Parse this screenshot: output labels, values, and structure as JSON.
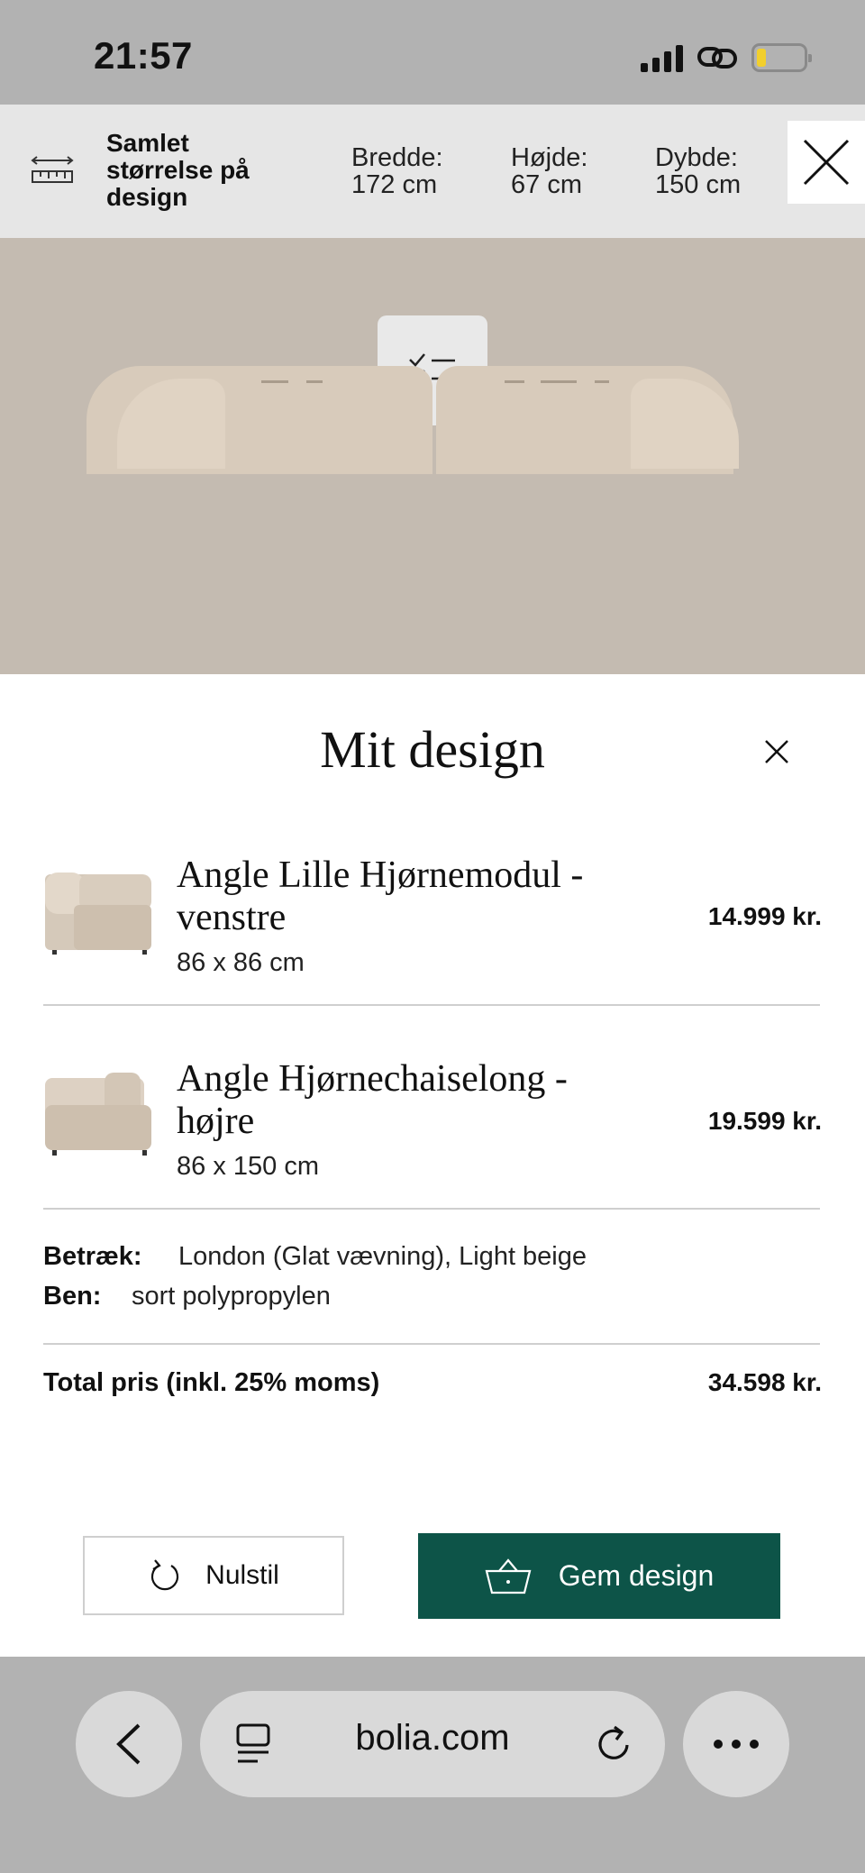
{
  "status_bar": {
    "time": "21:57"
  },
  "dimensions": {
    "title": "Samlet størrelse på design",
    "width_label": "Bredde:",
    "width_value": "172 cm",
    "height_label": "Højde:",
    "height_value": "67 cm",
    "depth_label": "Dybde:",
    "depth_value": "150 cm"
  },
  "panel": {
    "title": "Mit design",
    "items": [
      {
        "name": "Angle Lille Hjørnemodul - venstre",
        "size": "86 x 86 cm",
        "price": "14.999 kr."
      },
      {
        "name": "Angle Hjørnechaiselong - højre",
        "size": "86 x 150 cm",
        "price": "19.599 kr."
      }
    ],
    "specs": {
      "cover_label": "Betræk:",
      "cover_value": "London (Glat vævning), Light beige",
      "legs_label": "Ben:",
      "legs_value": "sort polypropylen"
    },
    "total_label": "Total pris (inkl. 25% moms)",
    "total_value": "34.598 kr.",
    "reset_label": "Nulstil",
    "save_label": "Gem design"
  },
  "browser": {
    "domain": "bolia.com"
  },
  "colors": {
    "accent": "#0d5448",
    "fabric": "#d8cbbb",
    "backdrop": "#c4bbb1"
  }
}
